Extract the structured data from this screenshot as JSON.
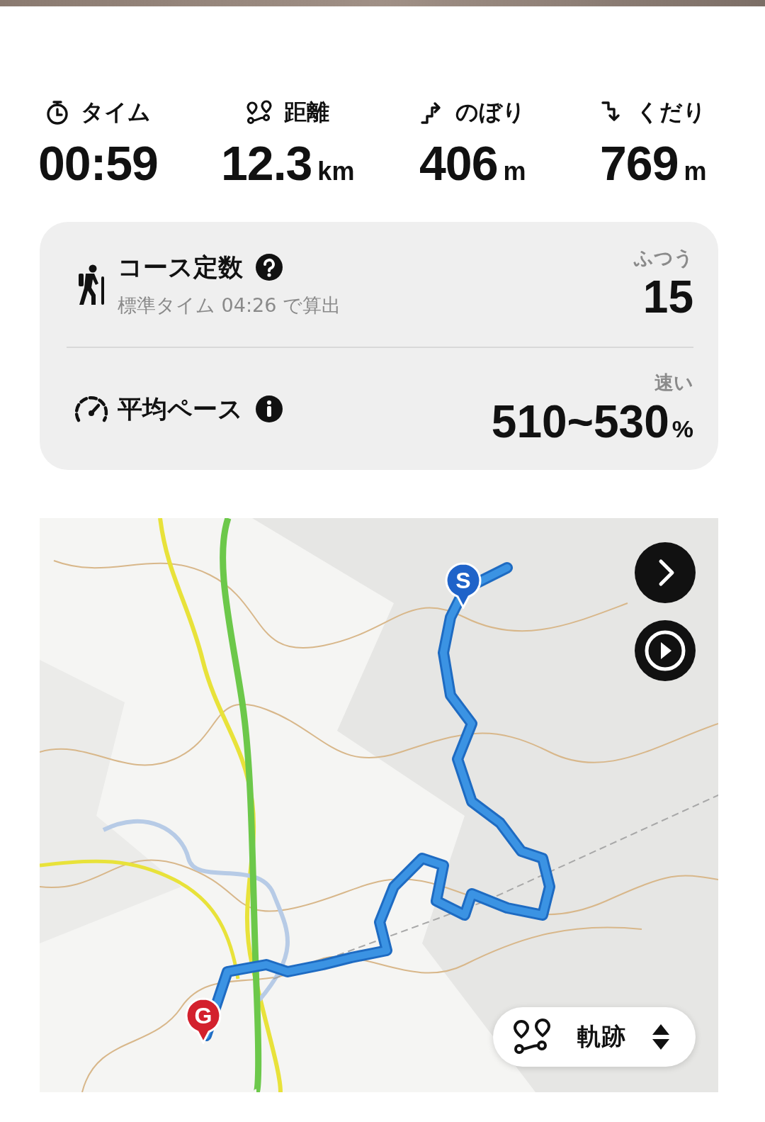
{
  "stats": [
    {
      "kind": "time",
      "label": "タイム",
      "value": "00:59"
    },
    {
      "kind": "distance",
      "label": "距離",
      "value": "12.3",
      "unit": "km"
    },
    {
      "kind": "ascent",
      "label": "のぼり",
      "value": "406",
      "unit": "m"
    },
    {
      "kind": "descent",
      "label": "くだり",
      "value": "769",
      "unit": "m"
    }
  ],
  "summary": [
    {
      "kind": "course",
      "label": "コース定数",
      "note": "標準タイム 04:26 で算出",
      "rating": "ふつう",
      "value": "15"
    },
    {
      "kind": "pace",
      "label": "平均ペース",
      "rating": "速い",
      "value": "510~530",
      "unit": "%"
    }
  ],
  "map": {
    "kind": "picture",
    "markers": [
      {
        "kind": "start",
        "label": "S",
        "color": "#1f63c9"
      },
      {
        "kind": "goal",
        "label": "G",
        "color": "#d3212d"
      }
    ],
    "controls": [
      {
        "kind": "next"
      },
      {
        "kind": "play"
      }
    ],
    "layer_selector": {
      "label": "軌跡"
    }
  }
}
